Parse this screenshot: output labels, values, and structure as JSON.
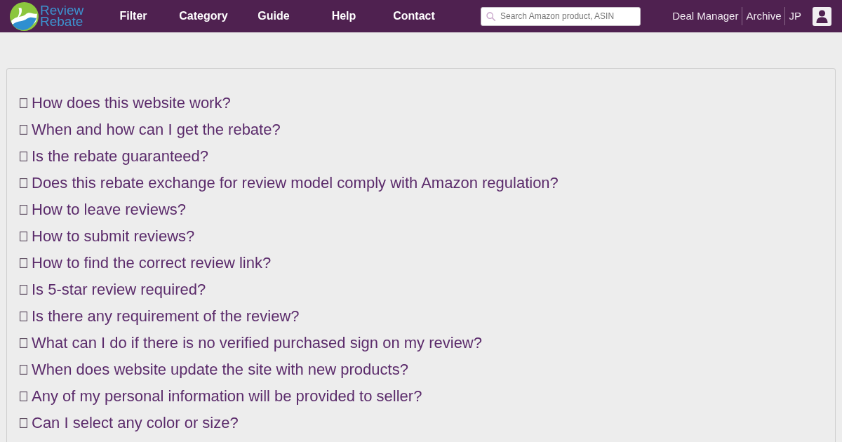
{
  "logo": {
    "line_1": "Review",
    "line_2": "Rebate"
  },
  "nav": {
    "links": [
      "Filter",
      "Category",
      "Guide",
      "Help",
      "Contact"
    ]
  },
  "search": {
    "placeholder": "Search Amazon product, ASIN"
  },
  "account_links": [
    "Deal Manager",
    "Archive",
    "JP"
  ],
  "faq": {
    "questions": [
      "How does this website work?",
      "When and how can I get the rebate?",
      "Is the rebate guaranteed?",
      "Does this rebate exchange for review model comply with Amazon regulation?",
      "How to leave reviews?",
      "How to submit reviews?",
      "How to find the correct review link?",
      "Is 5-star review required?",
      "Is there any requirement of the review?",
      "What can I do if there is no verified purchased sign on my review?",
      "When does website update the site with new products?",
      "Any of my personal information will be provided to seller?",
      "Can I select any color or size?"
    ]
  }
}
